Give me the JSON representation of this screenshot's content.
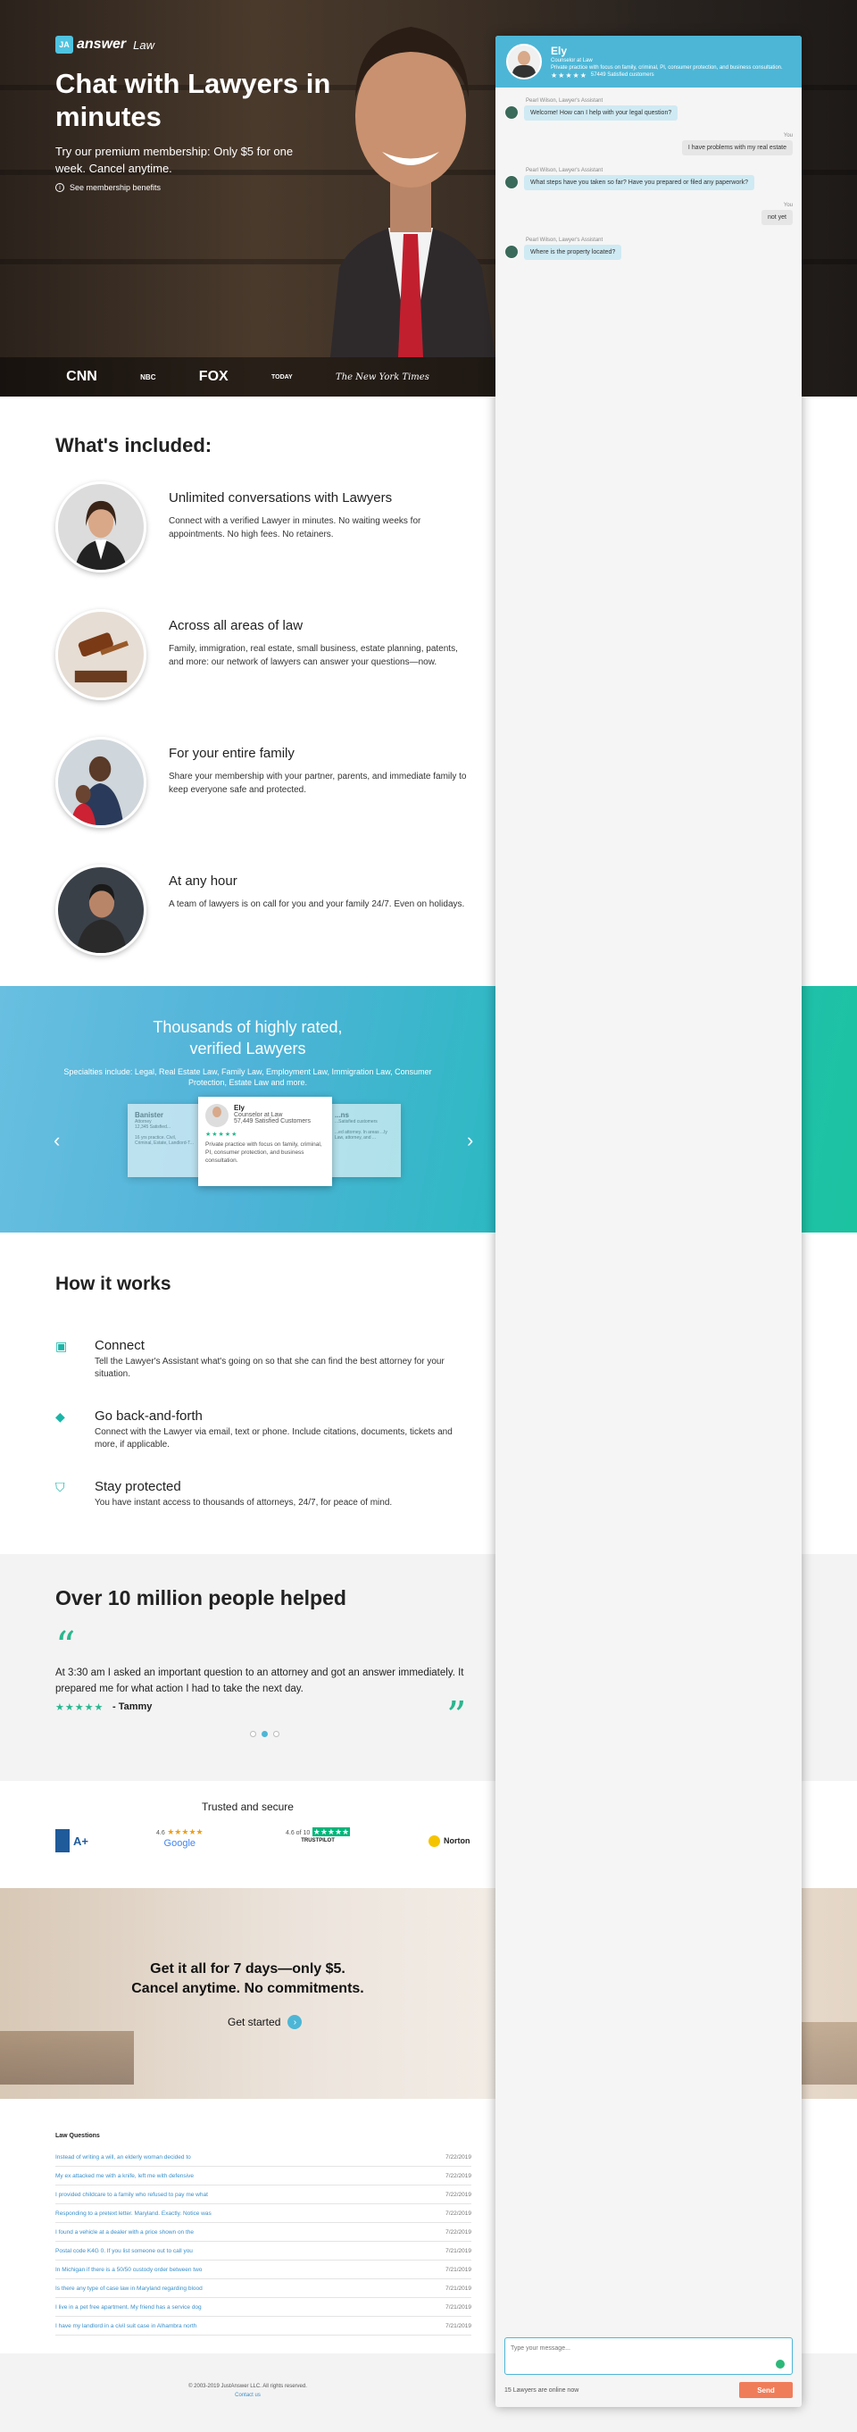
{
  "hero": {
    "logo_word": "answer",
    "logo_sub": "Law",
    "title": "Chat with Lawyers in minutes",
    "subtitle": "Try our premium membership: Only $5 for one week. Cancel anytime.",
    "benefits_link": "See membership benefits",
    "press": [
      "CNN",
      "NBC",
      "FOX",
      "TODAY",
      "The New York Times"
    ]
  },
  "chat": {
    "expert_name": "Ely",
    "expert_role": "Counselor at Law",
    "expert_desc": "Private practice with focus on family, criminal, PI, consumer protection, and business consultation.",
    "expert_stars": "★★★★★",
    "expert_customers": "57449 Satisfied customers",
    "messages": [
      {
        "from": "assistant",
        "label": "Pearl Wilson, Lawyer's Assistant",
        "text": "Welcome! How can I help with your legal question?"
      },
      {
        "from": "user",
        "label": "You",
        "text": "I have problems with my real estate"
      },
      {
        "from": "assistant",
        "label": "Pearl Wilson, Lawyer's Assistant",
        "text": "What steps have you taken so far? Have you prepared or filed any paperwork?"
      },
      {
        "from": "user",
        "label": "You",
        "text": "not yet"
      },
      {
        "from": "assistant",
        "label": "Pearl Wilson, Lawyer's Assistant",
        "text": "Where is the property located?"
      }
    ],
    "input_placeholder": "Type your message...",
    "online": "15 Lawyers are online now",
    "send": "Send"
  },
  "included": {
    "title": "What's included:",
    "items": [
      {
        "title": "Unlimited conversations with Lawyers",
        "text": "Connect with a verified Lawyer in minutes. No waiting weeks for appointments. No high fees. No retainers."
      },
      {
        "title": "Across all areas of law",
        "text": "Family, immigration, real estate, small business, estate planning, patents, and more: our network of lawyers can answer your questions—now."
      },
      {
        "title": "For your entire family",
        "text": "Share your membership with your partner, parents, and immediate family to keep everyone safe and protected."
      },
      {
        "title": "At any hour",
        "text": "A team of lawyers is on call for you and your family 24/7. Even on holidays."
      }
    ]
  },
  "lawyers": {
    "title_1": "Thousands of highly rated,",
    "title_2": "verified Lawyers",
    "specialties": "Specialties include: Legal, Real Estate Law, Family Law, Employment Law, Immigration Law, Consumer Protection, Estate Law and more.",
    "left_card": {
      "name": "Banister",
      "role": "Attorney",
      "customers": "12,345 Satisfied...",
      "text": "16 yrs practice. Civil, Criminal, Estate, Landlord-T..."
    },
    "right_card": {
      "name": "...ns",
      "role": "",
      "customers": "...Satisfied customers",
      "text": "...ed attorney. In areas ...ly Law, attorney, and ..."
    },
    "main_card": {
      "name": "Ely",
      "role": "Counselor at Law",
      "customers": "57,449 Satisfied Customers",
      "stars": "★★★★★",
      "text": "Private practice with focus on family, criminal, PI, consumer protection, and business consultation."
    }
  },
  "how": {
    "title": "How it works",
    "steps": [
      {
        "title": "Connect",
        "text": "Tell the Lawyer's Assistant what's going on so that she can find the best attorney for your situation."
      },
      {
        "title": "Go back-and-forth",
        "text": "Connect with the Lawyer via email, text or phone. Include citations, documents, tickets and more, if applicable."
      },
      {
        "title": "Stay protected",
        "text": "You have instant access to thousands of attorneys, 24/7, for peace of mind."
      }
    ]
  },
  "testimonial": {
    "title": "Over 10 million people helped",
    "quote": "At 3:30 am I asked an important question to an attorney and got an answer immediately. It prepared me for what action I had to take the next day.",
    "stars": "★★★★★",
    "author": "- Tammy"
  },
  "trust": {
    "title": "Trusted and secure",
    "bbb": "A+",
    "google_score": "4.6",
    "google_name": "Google",
    "trustpilot_score": "4.6 of 10",
    "trustpilot_name": "TRUSTPILOT",
    "norton": "Norton"
  },
  "cta": {
    "line1": "Get it all for 7 days—only $5.",
    "line2": "Cancel anytime. No commitments.",
    "button": "Get started"
  },
  "questions": {
    "title": "Law Questions",
    "items": [
      {
        "q": "Instead of writing a will, an elderly woman decided to",
        "d": "7/22/2019"
      },
      {
        "q": "My ex attacked me with a knife, left me with defensive",
        "d": "7/22/2019"
      },
      {
        "q": "I provided childcare to a family who refused to pay me what",
        "d": "7/22/2019"
      },
      {
        "q": "Responding to a pretext letter. Maryland. Exactly. Notice was",
        "d": "7/22/2019"
      },
      {
        "q": "I found a vehicle at a dealer with a price shown on the",
        "d": "7/22/2019"
      },
      {
        "q": "Postal code K4G 0. If you list someone out to call you",
        "d": "7/21/2019"
      },
      {
        "q": "In Michigan if there is a 50/50 custody order between two",
        "d": "7/21/2019"
      },
      {
        "q": "Is there any type of case law in Maryland regarding blood",
        "d": "7/21/2019"
      },
      {
        "q": "I live in a pet free apartment. My friend has a service dog",
        "d": "7/21/2019"
      },
      {
        "q": "I have my landlord in a civil suit case in Alhambra north",
        "d": "7/21/2019"
      }
    ]
  },
  "footer": {
    "copyright": "© 2003-2019 JustAnswer LLC. All rights reserved.",
    "contact": "Contact us"
  },
  "colors": {
    "accent": "#4db6d6",
    "green": "#2ab68e",
    "send": "#f07d5a"
  }
}
